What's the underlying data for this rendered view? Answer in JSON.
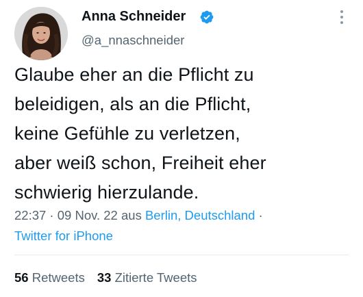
{
  "author": {
    "display_name": "Anna Schneider",
    "handle": "@a_nnaschneider",
    "verified": true
  },
  "tweet": {
    "text": "Glaube eher an die Pflicht zu\nbeleidigen, als an die Pflicht,\nkeine Gefühle zu verletzen,\naber weiß schon, Freiheit eher\nschwierig hierzulande."
  },
  "meta": {
    "time": "22:37",
    "separator": " · ",
    "date": "09 Nov. 22",
    "location_prefix": " aus ",
    "location": "Berlin, Deutschland",
    "trailing_separator": " ·",
    "source": "Twitter for iPhone"
  },
  "stats": {
    "retweets_count": "56",
    "retweets_label": "Retweets",
    "quotes_count": "33",
    "quotes_label": "Zitierte Tweets"
  },
  "colors": {
    "text": "#0f1419",
    "secondary": "#536471",
    "link": "#1d9bf0",
    "verified": "#1d9bf0"
  }
}
